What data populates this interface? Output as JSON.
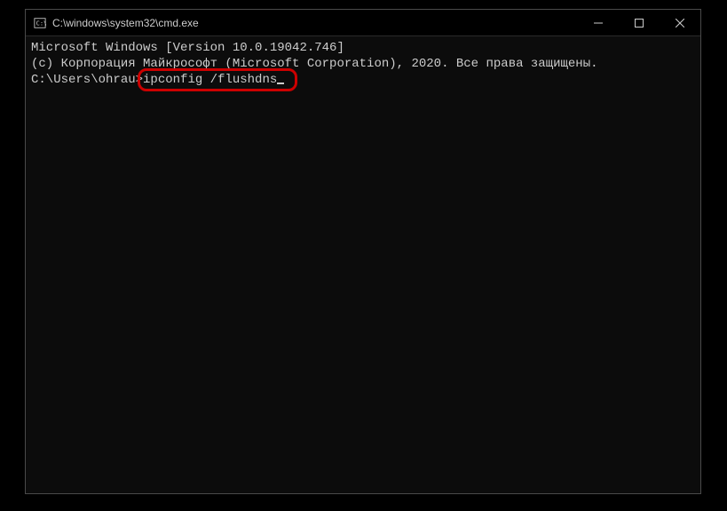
{
  "window": {
    "title": "C:\\windows\\system32\\cmd.exe"
  },
  "terminal": {
    "line1": "Microsoft Windows [Version 10.0.19042.746]",
    "line2": "(c) Корпорация Майкрософт (Microsoft Corporation), 2020. Все права защищены.",
    "blank": "",
    "prompt": "C:\\Users\\ohrau>",
    "command": "ipconfig /flushdns"
  }
}
